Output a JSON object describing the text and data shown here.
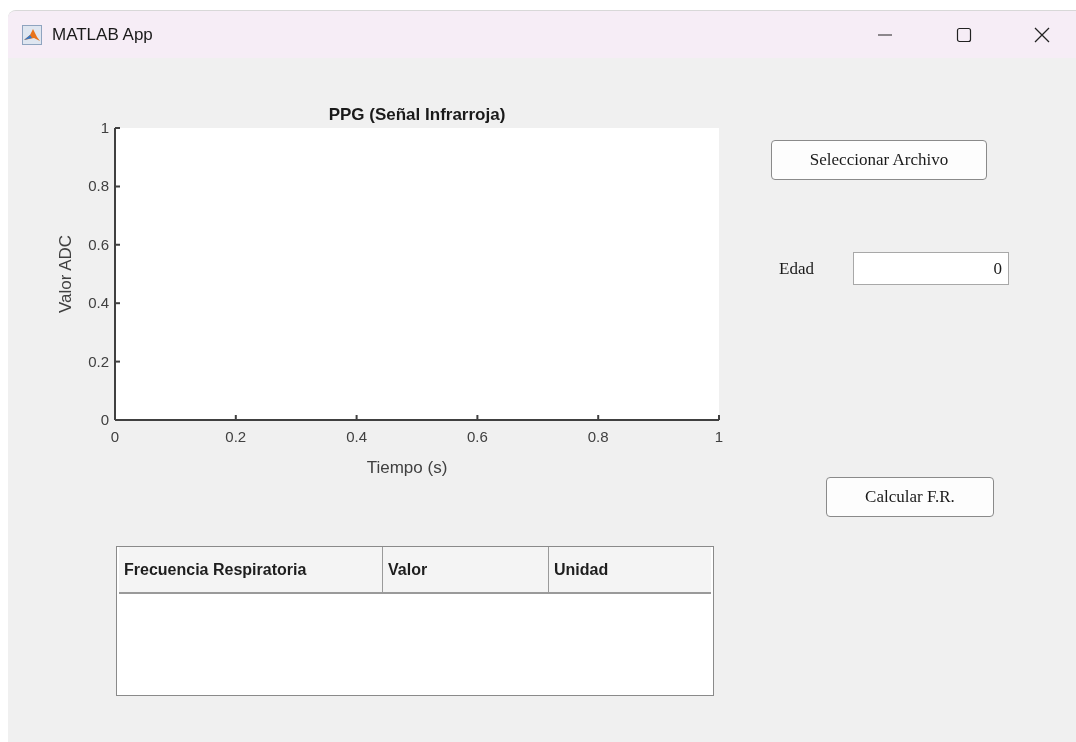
{
  "window": {
    "title": "MATLAB App"
  },
  "axes": {
    "chart_data": {
      "type": "line",
      "title": "PPG (Señal Infrarroja)",
      "xlabel": "Tiempo (s)",
      "ylabel": "Valor ADC",
      "xlim": [
        0,
        1
      ],
      "ylim": [
        0,
        1
      ],
      "xticks": [
        0,
        0.2,
        0.4,
        0.6,
        0.8,
        1
      ],
      "yticks": [
        0,
        0.2,
        0.4,
        0.6,
        0.8,
        1
      ]
    }
  },
  "select_button": {
    "label": "Seleccionar Archivo"
  },
  "age_field": {
    "label": "Edad",
    "value": "0"
  },
  "calc_button": {
    "label": "Calcular F.R."
  },
  "table": {
    "columns": [
      "Frecuencia Respiratoria",
      "Valor",
      "Unidad"
    ]
  }
}
